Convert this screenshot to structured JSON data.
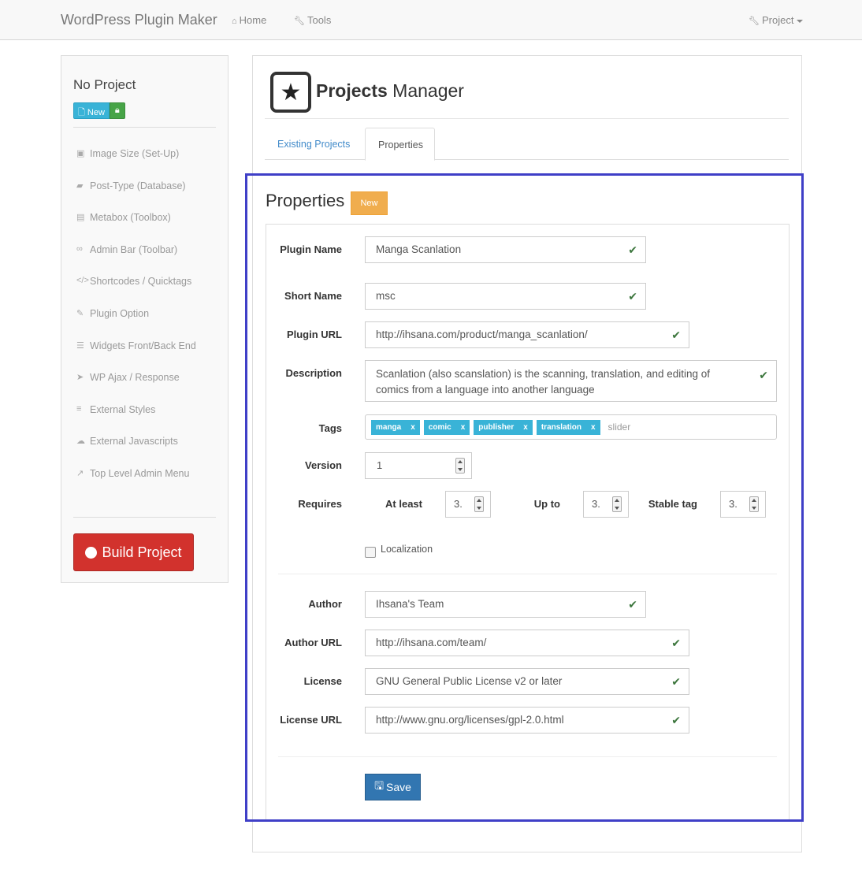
{
  "navbar": {
    "brand": "WordPress Plugin Maker",
    "home": "Home",
    "tools": "Tools",
    "project": "Project"
  },
  "sidebar": {
    "title": "No Project",
    "new_label": "New",
    "items": [
      {
        "label": "Image Size (Set-Up)",
        "icon": "image-icon"
      },
      {
        "label": "Post-Type (Database)",
        "icon": "book-icon"
      },
      {
        "label": "Metabox (Toolbox)",
        "icon": "list-icon"
      },
      {
        "label": "Admin Bar (Toolbar)",
        "icon": "link-icon"
      },
      {
        "label": "Shortcodes / Quicktags",
        "icon": "code-icon"
      },
      {
        "label": "Plugin Option",
        "icon": "wrench-icon"
      },
      {
        "label": "Widgets Front/Back End",
        "icon": "widgets-icon"
      },
      {
        "label": "WP Ajax / Response",
        "icon": "arrow-icon"
      },
      {
        "label": "External Styles",
        "icon": "css-icon"
      },
      {
        "label": "External Javascripts",
        "icon": "cloud-icon"
      },
      {
        "label": "Top Level Admin Menu",
        "icon": "chart-icon"
      }
    ],
    "build_label": "Build Project"
  },
  "manager": {
    "title_bold": "Projects",
    "title_rest": "Manager",
    "tabs": [
      "Existing Projects",
      "Properties"
    ],
    "active_tab": "Properties"
  },
  "properties": {
    "title": "Properties",
    "badge": "New",
    "fields": {
      "plugin_name": {
        "label": "Plugin Name",
        "value": "Manga Scanlation"
      },
      "short_name": {
        "label": "Short Name",
        "value": "msc"
      },
      "plugin_url": {
        "label": "Plugin URL",
        "value": "http://ihsana.com/product/manga_scanlation/"
      },
      "description": {
        "label": "Description",
        "value": "Scanlation (also scanslation) is the scanning, translation, and editing of comics from a language into another language"
      },
      "tags": {
        "label": "Tags",
        "items": [
          "manga",
          "comic",
          "publisher",
          "translation"
        ],
        "placeholder": "slider"
      },
      "version": {
        "label": "Version",
        "value": "1"
      },
      "requires": {
        "label": "Requires",
        "at_least_label": "At least",
        "at_least": "3.",
        "up_to_label": "Up to",
        "up_to": "3.",
        "stable_label": "Stable tag",
        "stable": "3."
      },
      "localization": {
        "label": "Localization",
        "checked": false
      },
      "author": {
        "label": "Author",
        "value": "Ihsana's Team"
      },
      "author_url": {
        "label": "Author URL",
        "value": "http://ihsana.com/team/"
      },
      "license": {
        "label": "License",
        "value": "GNU General Public License v2 or later"
      },
      "license_url": {
        "label": "License URL",
        "value": "http://www.gnu.org/licenses/gpl-2.0.html"
      }
    },
    "save_label": "Save"
  },
  "colors": {
    "highlight": "#3f3fc7",
    "build": "#d2322d",
    "save": "#3276b1",
    "tag": "#39b3d7",
    "badge": "#f0ad4e"
  }
}
